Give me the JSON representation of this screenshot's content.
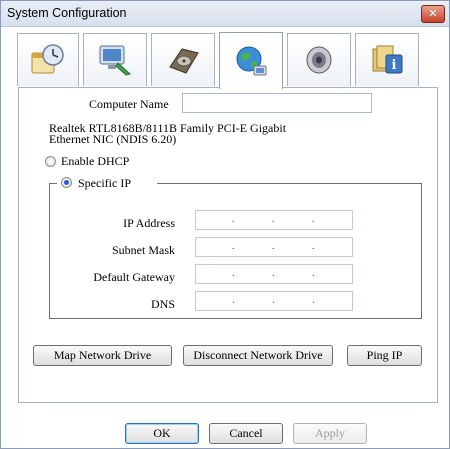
{
  "window": {
    "title": "System Configuration",
    "close_glyph": "✕"
  },
  "tabs": [
    {
      "icon": "clock-calendar-icon"
    },
    {
      "icon": "computer-network-icon"
    },
    {
      "icon": "hard-disk-icon"
    },
    {
      "icon": "globe-network-icon"
    },
    {
      "icon": "speaker-icon"
    },
    {
      "icon": "info-icon"
    }
  ],
  "network": {
    "computer_name_label": "Computer Name",
    "computer_name_value": "",
    "adapter_line1": "Realtek RTL8168B/8111B Family PCI-E Gigabit",
    "adapter_line2": "Ethernet NIC (NDIS 6.20)",
    "enable_dhcp_label": "Enable DHCP",
    "specific_ip_label": "Specific IP",
    "selected_mode": "Specific IP",
    "fields": {
      "ip_address_label": "IP Address",
      "subnet_mask_label": "Subnet Mask",
      "default_gateway_label": "Default Gateway",
      "dns_label": "DNS",
      "ip_separator": "."
    }
  },
  "actions": {
    "map_network_drive": "Map Network Drive",
    "disconnect_network_drive": "Disconnect Network Drive",
    "ping_ip": "Ping IP"
  },
  "footer": {
    "ok": "OK",
    "cancel": "Cancel",
    "apply": "Apply"
  },
  "colors": {
    "accent": "#2f6fb7",
    "close": "#c8412a"
  }
}
